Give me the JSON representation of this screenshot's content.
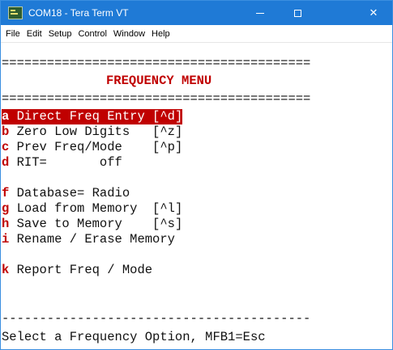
{
  "window": {
    "title": "COM18 - Tera Term VT",
    "icon": "tera-term-icon",
    "titlebar_color": "#1f7ad6",
    "controls": [
      "minimize",
      "maximize",
      "close"
    ],
    "close_glyph": "✕"
  },
  "menubar": {
    "items": [
      "File",
      "Edit",
      "Setup",
      "Control",
      "Window",
      "Help"
    ]
  },
  "terminal": {
    "separator_double": "=========================================",
    "menu_title": "FREQUENCY MENU",
    "items": [
      {
        "key": "a",
        "label": " Direct Freq Entry [^d]",
        "selected": true
      },
      {
        "key": "b",
        "label": " Zero Low Digits   [^z]",
        "selected": false
      },
      {
        "key": "c",
        "label": " Prev Freq/Mode    [^p]",
        "selected": false
      },
      {
        "key": "d",
        "label": " RIT=       off",
        "selected": false
      },
      {
        "key": "f",
        "label": " Database= Radio",
        "selected": false
      },
      {
        "key": "g",
        "label": " Load from Memory  [^l]",
        "selected": false
      },
      {
        "key": "h",
        "label": " Save to Memory    [^s]",
        "selected": false
      },
      {
        "key": "i",
        "label": " Rename / Erase Memory",
        "selected": false
      },
      {
        "key": "k",
        "label": " Report Freq / Mode",
        "selected": false
      }
    ],
    "separator_single": "-----------------------------------------",
    "prompt": "Select a Frequency Option, MFB1=Esc",
    "colors": {
      "hotkey": "#c00000",
      "selection_bg": "#c00000",
      "text": "#111111"
    }
  }
}
